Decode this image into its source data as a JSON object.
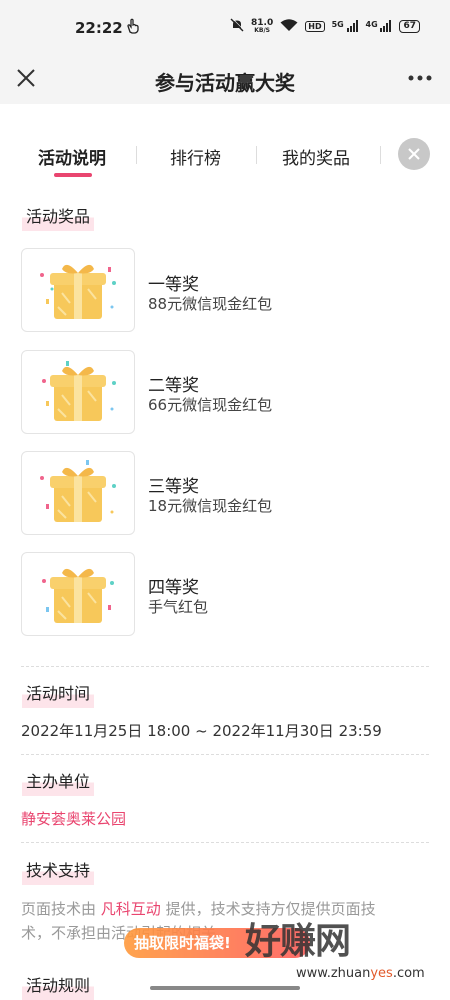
{
  "status_bar": {
    "time": "22:22",
    "net_speed_value": "81.0",
    "net_speed_unit": "KB/S",
    "hd_label": "HD",
    "signal1_label": "5G",
    "signal2_label": "4G",
    "battery": "67"
  },
  "nav": {
    "title": "参与活动赢大奖"
  },
  "tabs": [
    {
      "label": "活动说明",
      "active": true
    },
    {
      "label": "排行榜",
      "active": false
    },
    {
      "label": "我的奖品",
      "active": false
    }
  ],
  "sections": {
    "prizes_title": "活动奖品",
    "time_title": "活动时间",
    "organizer_title": "主办单位",
    "tech_title": "技术支持",
    "rules_title": "活动规则"
  },
  "prizes": [
    {
      "name": "一等奖",
      "desc": "88元微信现金红包"
    },
    {
      "name": "二等奖",
      "desc": "66元微信现金红包"
    },
    {
      "name": "三等奖",
      "desc": "18元微信现金红包"
    },
    {
      "name": "四等奖",
      "desc": "手气红包"
    }
  ],
  "activity_time": "2022年11月25日 18:00 ~ 2022年11月30日 23:59",
  "organizer": "静安荟奥莱公园",
  "tech_support": {
    "prefix": "页面技术由 ",
    "company": "凡科互动",
    "suffix": " 提供，技术支持方仅提供页面技",
    "line2": "术，不承担由活动引起的相关"
  },
  "banner": "抽取限时福袋!",
  "watermark": {
    "main": "好赚网",
    "sub_a": "www.zhuan",
    "sub_b": "yes",
    "sub_c": ".com"
  },
  "colors": {
    "accent": "#e9456f",
    "gift": "#f7c85a"
  }
}
